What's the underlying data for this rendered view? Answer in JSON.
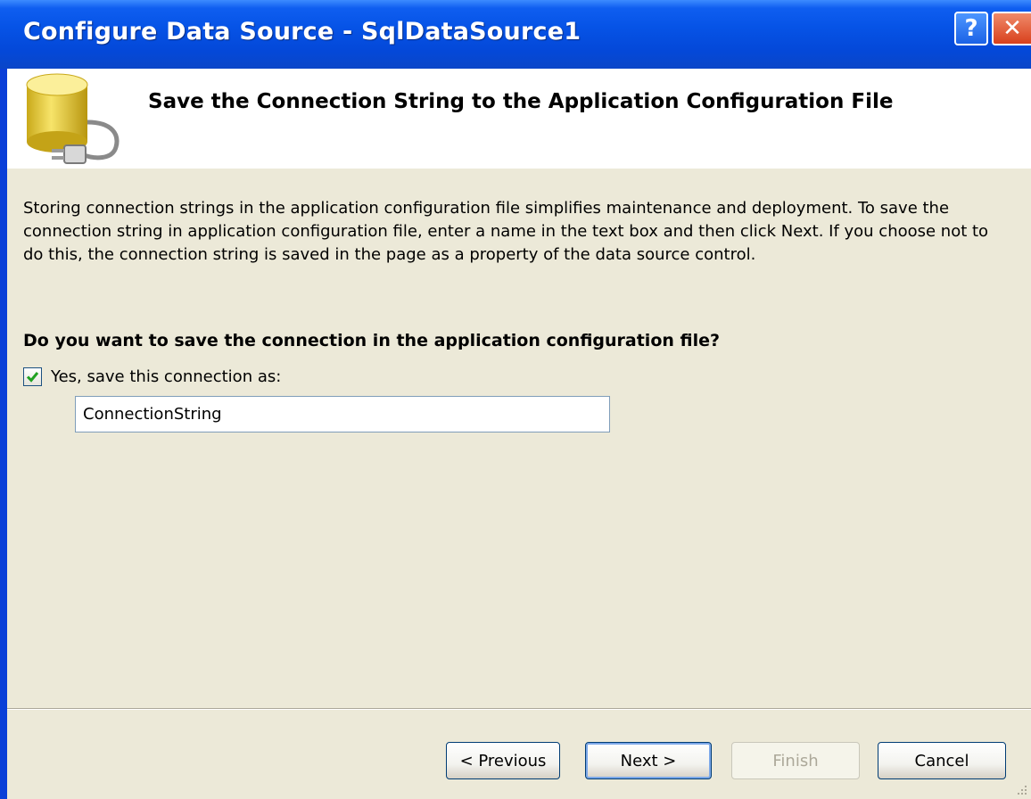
{
  "window": {
    "title": "Configure Data Source - SqlDataSource1",
    "help_glyph": "?",
    "close_glyph": "✕"
  },
  "header": {
    "icon": "database-plug-icon",
    "title": "Save the Connection String to the Application Configuration File"
  },
  "body": {
    "description": "Storing connection strings in the application configuration file simplifies maintenance and deployment. To save the connection string in application configuration file, enter a name in the text box and then click Next. If you choose not to do this, the connection string is saved in the page as a property of the data source control.",
    "question": "Do you want to save the connection in the application configuration file?",
    "save_checkbox": {
      "label": "Yes, save this connection as:",
      "checked": true
    },
    "connection_name": {
      "value": "ConnectionString"
    }
  },
  "footer": {
    "previous_label": "< Previous",
    "next_label": "Next >",
    "finish_label": "Finish",
    "cancel_label": "Cancel"
  },
  "colors": {
    "title_bar": "#0653e6",
    "dialog_bg": "#ece9d8",
    "check_green": "#21a121"
  }
}
